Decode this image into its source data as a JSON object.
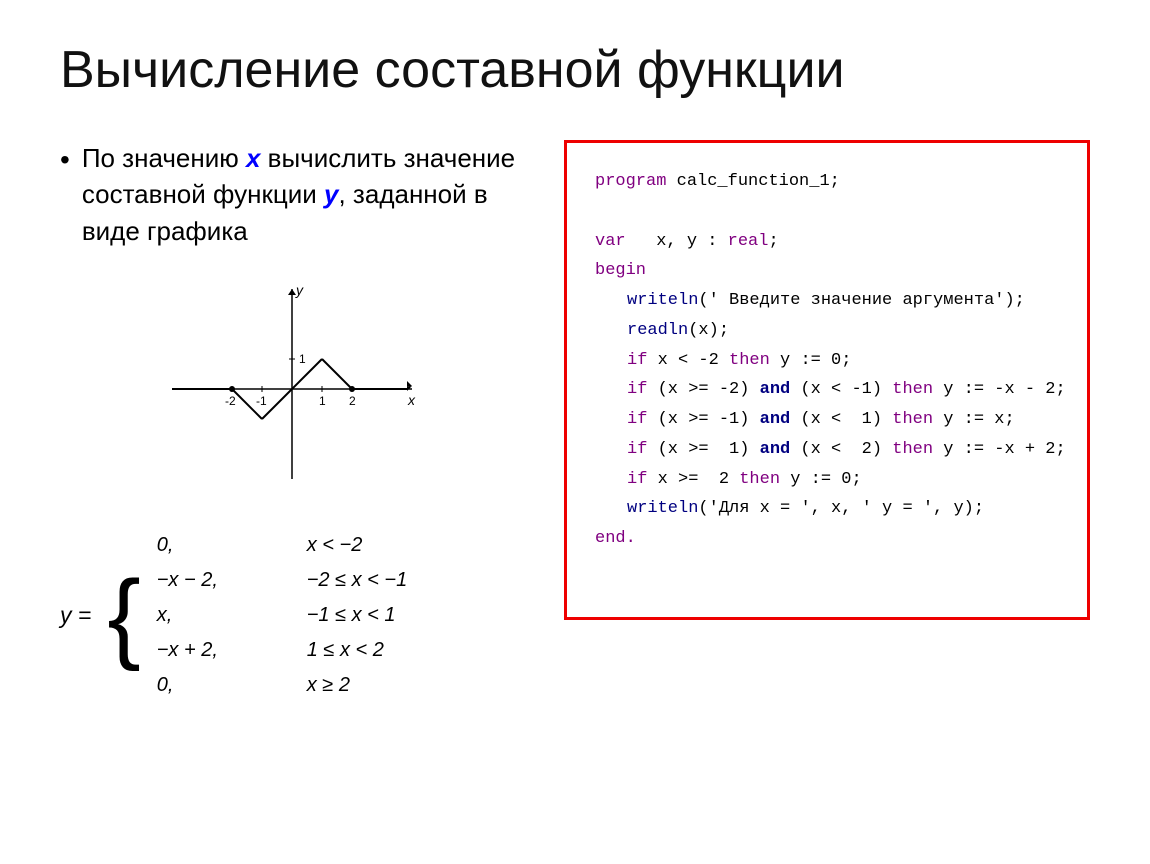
{
  "title": "Вычисление составной функции",
  "left": {
    "bullet": "По значению ",
    "x_var": "x",
    "bullet_mid": " вычислить значение составной функции ",
    "y_var": "y",
    "bullet_end": ", заданной в виде графика",
    "formula": {
      "y_label": "y =",
      "cases": [
        {
          "left": "0,",
          "right": "x < −2"
        },
        {
          "left": "−x − 2,",
          "right": "−2 ≤ x < −1"
        },
        {
          "left": "x,",
          "right": "−1 ≤ x < 1"
        },
        {
          "left": "−x + 2,",
          "right": "1 ≤ x < 2"
        },
        {
          "left": "0,",
          "right": "x ≥ 2"
        }
      ]
    }
  },
  "code": {
    "lines": [
      {
        "indent": 0,
        "text": "program calc_function_1;"
      },
      {
        "indent": 0,
        "text": ""
      },
      {
        "indent": 0,
        "text": "var   x, y : real;"
      },
      {
        "indent": 0,
        "text": "begin"
      },
      {
        "indent": 1,
        "text": "writeln(' Введите значение аргумента');"
      },
      {
        "indent": 1,
        "text": "readln(x);"
      },
      {
        "indent": 1,
        "text": "if x < -2 then y := 0;"
      },
      {
        "indent": 1,
        "text": "if (x >= -2) and (x < -1) then y := -x - 2;"
      },
      {
        "indent": 1,
        "text": "if (x >= -1) and (x <  1) then y := x;"
      },
      {
        "indent": 1,
        "text": "if (x >=  1) and (x <  2) then y := -x + 2;"
      },
      {
        "indent": 1,
        "text": "if x >=  2 then y := 0;"
      },
      {
        "indent": 1,
        "text": "writeln('Для x = ', x, ' y = ', y);"
      },
      {
        "indent": 0,
        "text": "end."
      }
    ]
  }
}
